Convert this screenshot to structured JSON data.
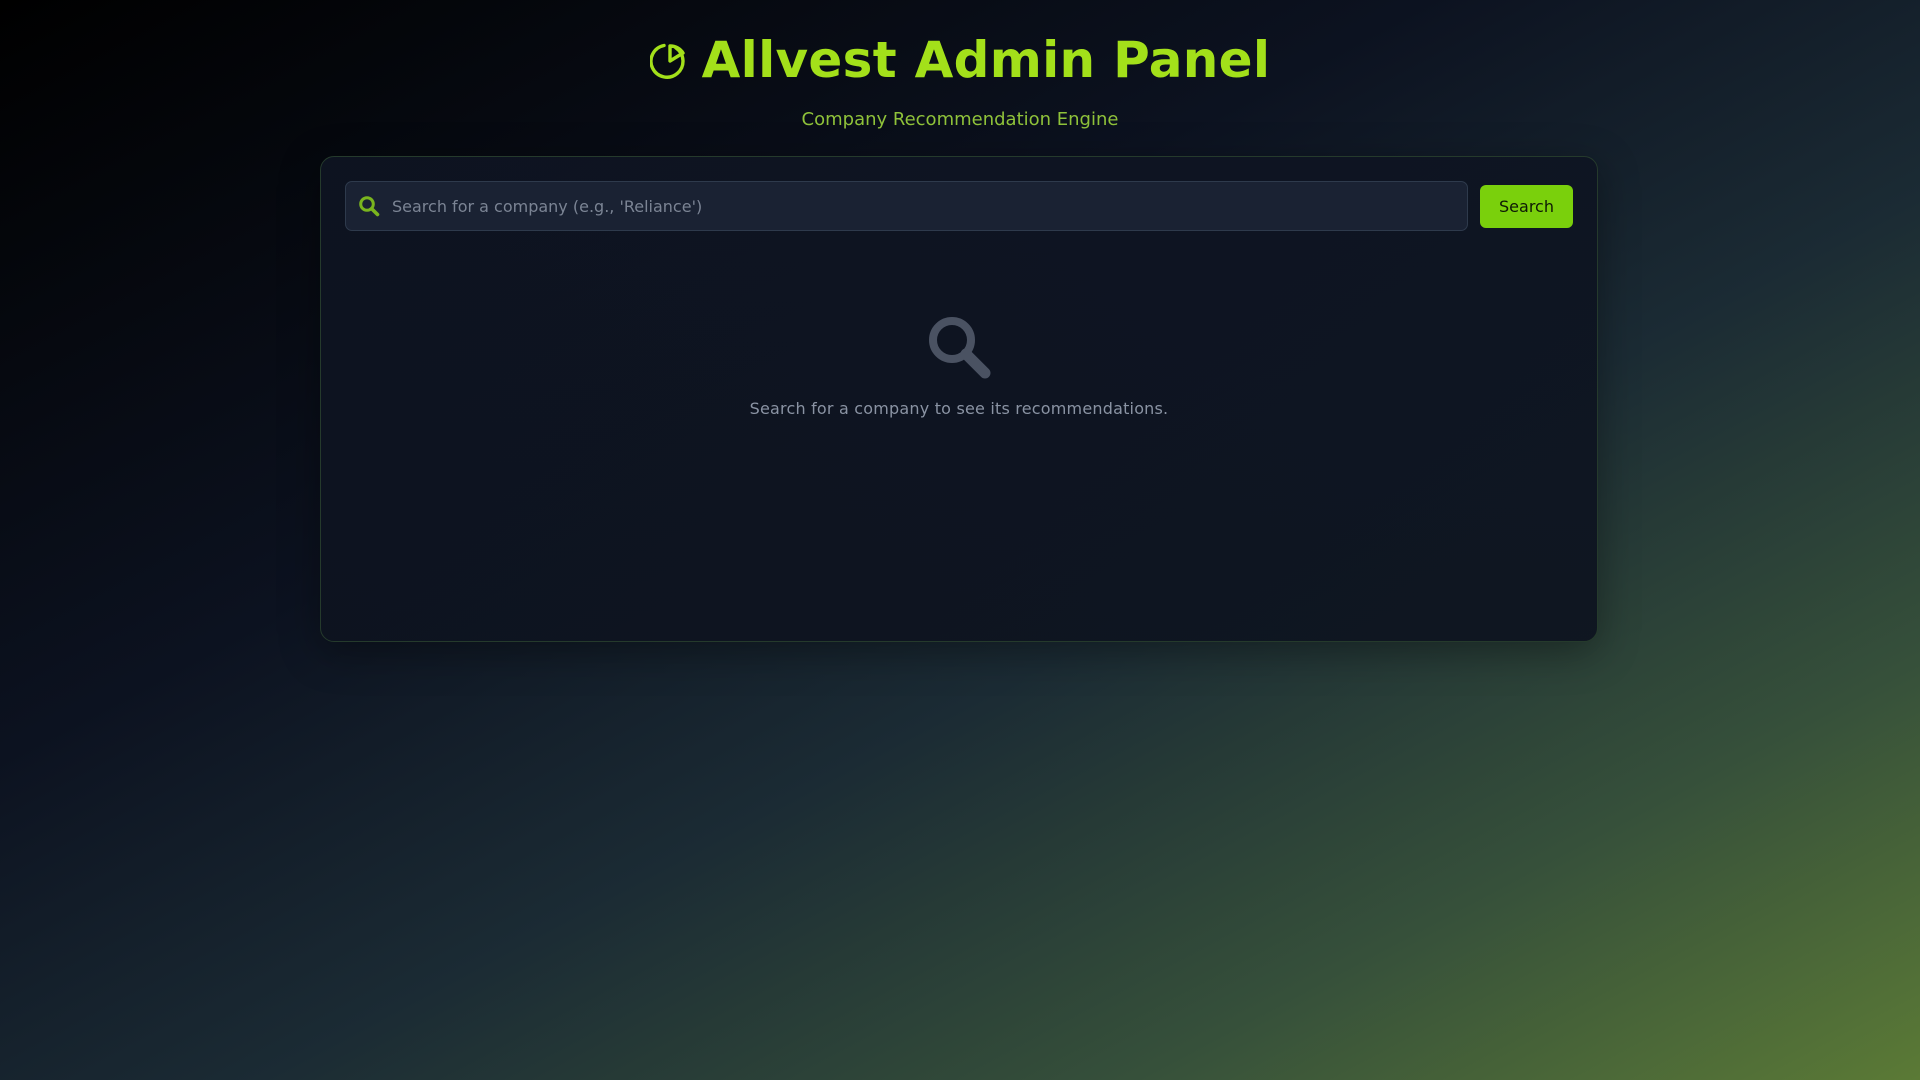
{
  "header": {
    "title": "Allvest Admin Panel",
    "subtitle": "Company Recommendation Engine",
    "logo_icon": "pie-chart-icon"
  },
  "search": {
    "placeholder": "Search for a company (e.g., 'Reliance')",
    "value": "",
    "icon": "search-icon",
    "button_label": "Search"
  },
  "empty_state": {
    "icon": "search-icon",
    "message": "Search for a company to see its recommendations."
  },
  "colors": {
    "accent": "#a3e01a",
    "button": "#7ad00c",
    "subtitle": "#8fc23a",
    "muted_icon": "#4a5262",
    "muted_text": "#8a93a3"
  }
}
